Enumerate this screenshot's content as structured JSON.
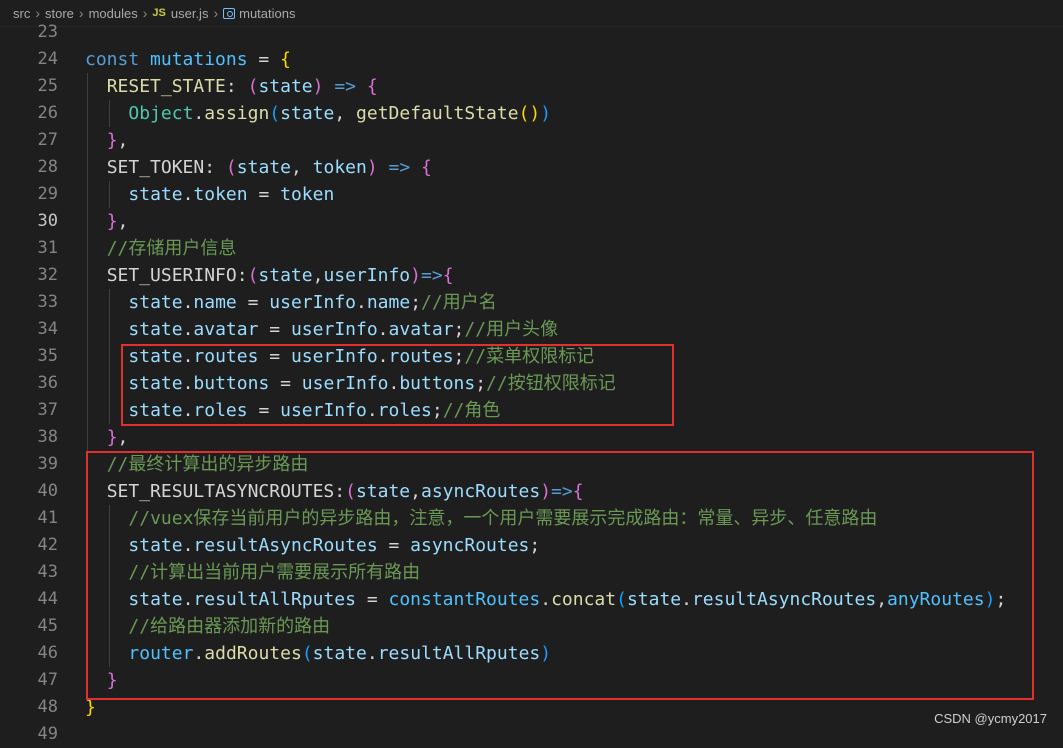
{
  "breadcrumb": {
    "items": [
      "src",
      "store",
      "modules",
      "user.js",
      "mutations"
    ],
    "file_icon": "JS",
    "symbol_icon": "symbol-variable-icon"
  },
  "editor": {
    "active_line": 30,
    "lines": [
      {
        "n": 23,
        "indent": 0,
        "tokens": []
      },
      {
        "n": 24,
        "indent": 0,
        "tokens": [
          [
            "kw",
            "const "
          ],
          [
            "const",
            "mutations"
          ],
          [
            "op",
            " = "
          ],
          [
            "br1",
            "{"
          ]
        ]
      },
      {
        "n": 25,
        "indent": 1,
        "tokens": [
          [
            "fn",
            "RESET_STATE"
          ],
          [
            "op",
            ": "
          ],
          [
            "br2",
            "("
          ],
          [
            "var",
            "state"
          ],
          [
            "br2",
            ")"
          ],
          [
            "op",
            " "
          ],
          [
            "arrow",
            "=>"
          ],
          [
            "op",
            " "
          ],
          [
            "br2",
            "{"
          ]
        ]
      },
      {
        "n": 26,
        "indent": 2,
        "tokens": [
          [
            "cls",
            "Object"
          ],
          [
            "op",
            "."
          ],
          [
            "fn",
            "assign"
          ],
          [
            "br3",
            "("
          ],
          [
            "var",
            "state"
          ],
          [
            "op",
            ", "
          ],
          [
            "fn",
            "getDefaultState"
          ],
          [
            "br1",
            "()"
          ],
          [
            "br3",
            ")"
          ]
        ]
      },
      {
        "n": 27,
        "indent": 1,
        "tokens": [
          [
            "br2",
            "}"
          ],
          [
            "op",
            ","
          ]
        ]
      },
      {
        "n": 28,
        "indent": 1,
        "tokens": [
          [
            "key",
            "SET_TOKEN"
          ],
          [
            "op",
            ": "
          ],
          [
            "br2",
            "("
          ],
          [
            "var",
            "state"
          ],
          [
            "op",
            ", "
          ],
          [
            "var",
            "token"
          ],
          [
            "br2",
            ")"
          ],
          [
            "op",
            " "
          ],
          [
            "arrow",
            "=>"
          ],
          [
            "op",
            " "
          ],
          [
            "br2",
            "{"
          ]
        ]
      },
      {
        "n": 29,
        "indent": 2,
        "tokens": [
          [
            "var",
            "state"
          ],
          [
            "op",
            "."
          ],
          [
            "prop",
            "token"
          ],
          [
            "op",
            " = "
          ],
          [
            "var",
            "token"
          ]
        ]
      },
      {
        "n": 30,
        "indent": 1,
        "tokens": [
          [
            "br2",
            "}"
          ],
          [
            "op",
            ","
          ]
        ]
      },
      {
        "n": 31,
        "indent": 1,
        "tokens": [
          [
            "cmt",
            "//存储用户信息"
          ]
        ]
      },
      {
        "n": 32,
        "indent": 1,
        "tokens": [
          [
            "key",
            "SET_USERINFO"
          ],
          [
            "op",
            ":"
          ],
          [
            "br2",
            "("
          ],
          [
            "var",
            "state"
          ],
          [
            "op",
            ","
          ],
          [
            "var",
            "userInfo"
          ],
          [
            "br2",
            ")"
          ],
          [
            "arrow",
            "=>"
          ],
          [
            "br2",
            "{"
          ]
        ]
      },
      {
        "n": 33,
        "indent": 2,
        "tokens": [
          [
            "var",
            "state"
          ],
          [
            "op",
            "."
          ],
          [
            "prop",
            "name"
          ],
          [
            "op",
            " = "
          ],
          [
            "var",
            "userInfo"
          ],
          [
            "op",
            "."
          ],
          [
            "prop",
            "name"
          ],
          [
            "op",
            ";"
          ],
          [
            "cmt",
            "//用户名"
          ]
        ]
      },
      {
        "n": 34,
        "indent": 2,
        "tokens": [
          [
            "var",
            "state"
          ],
          [
            "op",
            "."
          ],
          [
            "prop",
            "avatar"
          ],
          [
            "op",
            " = "
          ],
          [
            "var",
            "userInfo"
          ],
          [
            "op",
            "."
          ],
          [
            "prop",
            "avatar"
          ],
          [
            "op",
            ";"
          ],
          [
            "cmt",
            "//用户头像"
          ]
        ]
      },
      {
        "n": 35,
        "indent": 2,
        "tokens": [
          [
            "var",
            "state"
          ],
          [
            "op",
            "."
          ],
          [
            "prop",
            "routes"
          ],
          [
            "op",
            " = "
          ],
          [
            "var",
            "userInfo"
          ],
          [
            "op",
            "."
          ],
          [
            "prop",
            "routes"
          ],
          [
            "op",
            ";"
          ],
          [
            "cmt",
            "//菜单权限标记"
          ]
        ]
      },
      {
        "n": 36,
        "indent": 2,
        "tokens": [
          [
            "var",
            "state"
          ],
          [
            "op",
            "."
          ],
          [
            "prop",
            "buttons"
          ],
          [
            "op",
            " = "
          ],
          [
            "var",
            "userInfo"
          ],
          [
            "op",
            "."
          ],
          [
            "prop",
            "buttons"
          ],
          [
            "op",
            ";"
          ],
          [
            "cmt",
            "//按钮权限标记"
          ]
        ]
      },
      {
        "n": 37,
        "indent": 2,
        "tokens": [
          [
            "var",
            "state"
          ],
          [
            "op",
            "."
          ],
          [
            "prop",
            "roles"
          ],
          [
            "op",
            " = "
          ],
          [
            "var",
            "userInfo"
          ],
          [
            "op",
            "."
          ],
          [
            "prop",
            "roles"
          ],
          [
            "op",
            ";"
          ],
          [
            "cmt",
            "//角色"
          ]
        ]
      },
      {
        "n": 38,
        "indent": 1,
        "tokens": [
          [
            "br2",
            "}"
          ],
          [
            "op",
            ","
          ]
        ]
      },
      {
        "n": 39,
        "indent": 1,
        "tokens": [
          [
            "cmt",
            "//最终计算出的异步路由"
          ]
        ]
      },
      {
        "n": 40,
        "indent": 1,
        "tokens": [
          [
            "key",
            "SET_RESULTASYNCROUTES"
          ],
          [
            "op",
            ":"
          ],
          [
            "br2",
            "("
          ],
          [
            "var",
            "state"
          ],
          [
            "op",
            ","
          ],
          [
            "var",
            "asyncRoutes"
          ],
          [
            "br2",
            ")"
          ],
          [
            "arrow",
            "=>"
          ],
          [
            "br2",
            "{"
          ]
        ]
      },
      {
        "n": 41,
        "indent": 2,
        "tokens": [
          [
            "cmt",
            "//vuex保存当前用户的异步路由，注意，一个用户需要展示完成路由：常量、异步、任意路由"
          ]
        ]
      },
      {
        "n": 42,
        "indent": 2,
        "tokens": [
          [
            "var",
            "state"
          ],
          [
            "op",
            "."
          ],
          [
            "prop",
            "resultAsyncRoutes"
          ],
          [
            "op",
            " = "
          ],
          [
            "var",
            "asyncRoutes"
          ],
          [
            "op",
            ";"
          ]
        ]
      },
      {
        "n": 43,
        "indent": 2,
        "tokens": [
          [
            "cmt",
            "//计算出当前用户需要展示所有路由"
          ]
        ]
      },
      {
        "n": 44,
        "indent": 2,
        "tokens": [
          [
            "var",
            "state"
          ],
          [
            "op",
            "."
          ],
          [
            "prop",
            "resultAllRputes"
          ],
          [
            "op",
            " = "
          ],
          [
            "const",
            "constantRoutes"
          ],
          [
            "op",
            "."
          ],
          [
            "fn",
            "concat"
          ],
          [
            "br3",
            "("
          ],
          [
            "var",
            "state"
          ],
          [
            "op",
            "."
          ],
          [
            "prop",
            "resultAsyncRoutes"
          ],
          [
            "op",
            ","
          ],
          [
            "const",
            "anyRoutes"
          ],
          [
            "br3",
            ")"
          ],
          [
            "op",
            ";"
          ]
        ]
      },
      {
        "n": 45,
        "indent": 2,
        "tokens": [
          [
            "cmt",
            "//给路由器添加新的路由"
          ]
        ]
      },
      {
        "n": 46,
        "indent": 2,
        "tokens": [
          [
            "const",
            "router"
          ],
          [
            "op",
            "."
          ],
          [
            "fn",
            "addRoutes"
          ],
          [
            "br3",
            "("
          ],
          [
            "var",
            "state"
          ],
          [
            "op",
            "."
          ],
          [
            "prop",
            "resultAllRputes"
          ],
          [
            "br3",
            ")"
          ]
        ]
      },
      {
        "n": 47,
        "indent": 1,
        "tokens": [
          [
            "br2",
            "}"
          ]
        ]
      },
      {
        "n": 48,
        "indent": 0,
        "tokens": [
          [
            "br1",
            "}"
          ]
        ]
      },
      {
        "n": 49,
        "indent": 0,
        "tokens": []
      }
    ]
  },
  "watermark": "CSDN @ycmy2017"
}
